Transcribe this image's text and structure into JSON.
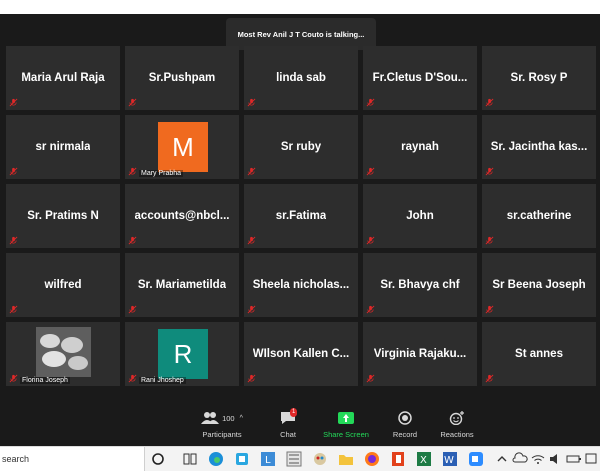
{
  "meeting": {
    "talking_banner": "Most Rev Anil J T Couto is talking..."
  },
  "tiles": [
    {
      "name": "Maria Arul Raja",
      "type": "name"
    },
    {
      "name": "Sr.Pushpam",
      "type": "name"
    },
    {
      "name": "linda sab",
      "type": "name"
    },
    {
      "name": "Fr.Cletus  D'Sou...",
      "type": "name"
    },
    {
      "name": "Sr. Rosy P",
      "type": "name"
    },
    {
      "name": "sr nirmala",
      "type": "name"
    },
    {
      "name": "Mary Prabha",
      "type": "avatar",
      "initial": "M",
      "color": "#f06a1f"
    },
    {
      "name": "Sr ruby",
      "type": "name"
    },
    {
      "name": "raynah",
      "type": "name"
    },
    {
      "name": "Sr.  Jacintha  kas...",
      "type": "name"
    },
    {
      "name": "Sr. Pratims N",
      "type": "name"
    },
    {
      "name": "accounts@nbcl...",
      "type": "name"
    },
    {
      "name": "sr.Fatima",
      "type": "name"
    },
    {
      "name": "John",
      "type": "name"
    },
    {
      "name": "sr.catherine",
      "type": "name"
    },
    {
      "name": "wilfred",
      "type": "name"
    },
    {
      "name": "Sr. Mariametilda",
      "type": "name"
    },
    {
      "name": "Sheela  nicholas...",
      "type": "name"
    },
    {
      "name": "Sr. Bhavya chf",
      "type": "name"
    },
    {
      "name": "Sr Beena Joseph",
      "type": "name"
    },
    {
      "name": "Florina Joseph",
      "type": "photo"
    },
    {
      "name": "Rani Jhoshep",
      "type": "avatar",
      "initial": "R",
      "color": "#0f8b7c"
    },
    {
      "name": "WIlson  Kallen  C...",
      "type": "name"
    },
    {
      "name": "Virginia  Rajaku...",
      "type": "name"
    },
    {
      "name": "St annes",
      "type": "name"
    }
  ],
  "toolbar": {
    "participants_label": "Participants",
    "participants_count": "100",
    "chat_label": "Chat",
    "chat_badge": "1",
    "share_label": "Share Screen",
    "record_label": "Record",
    "reactions_label": "Reactions",
    "share_color": "#23d959"
  },
  "taskbar": {
    "search_text": "search"
  }
}
